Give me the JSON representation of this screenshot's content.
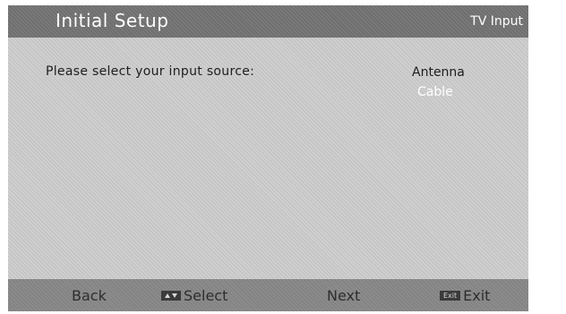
{
  "header": {
    "title": "Initial Setup",
    "section": "TV Input"
  },
  "main": {
    "prompt": "Please select your input source:",
    "options": [
      {
        "label": "Antenna",
        "selected": false
      },
      {
        "label": "Cable",
        "selected": true
      }
    ]
  },
  "footer": {
    "back_label": "Back",
    "select_label": "Select",
    "next_label": "Next",
    "exit_key_label": "Exit",
    "exit_label": "Exit"
  },
  "colors": {
    "header_bg": "#6f6f6f",
    "panel_bg": "#cfcfcf",
    "footer_bg": "#8b8b8b",
    "highlight_text": "#ffffff"
  }
}
